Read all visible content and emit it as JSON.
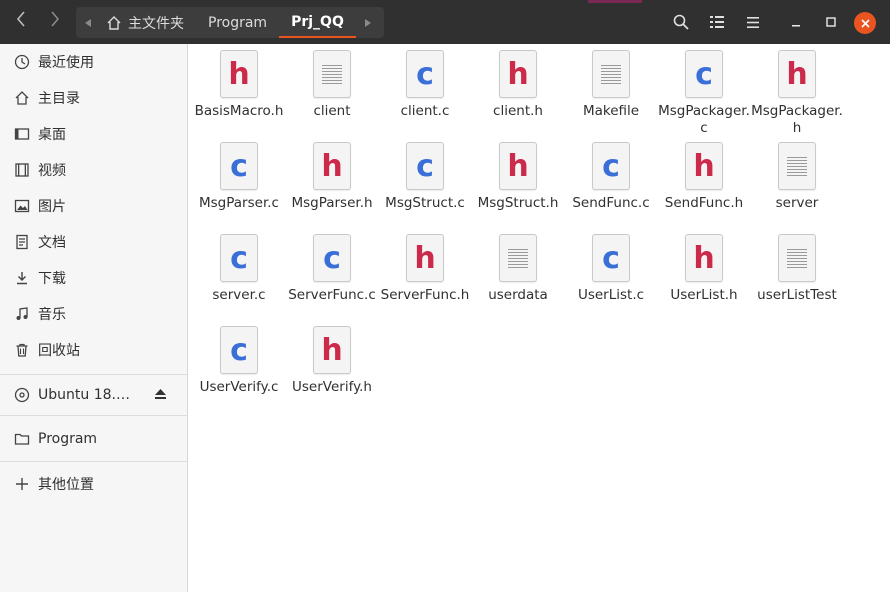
{
  "window": {
    "path": [
      {
        "label": "主文件夹",
        "icon": "home-icon"
      },
      {
        "label": "Program"
      },
      {
        "label": "Prj_QQ",
        "active": true
      }
    ]
  },
  "sidebar": {
    "places": [
      {
        "label": "最近使用",
        "icon": "clock-icon"
      },
      {
        "label": "主目录",
        "icon": "home-icon"
      },
      {
        "label": "桌面",
        "icon": "desktop-icon"
      },
      {
        "label": "视频",
        "icon": "video-icon"
      },
      {
        "label": "图片",
        "icon": "picture-icon"
      },
      {
        "label": "文档",
        "icon": "document-icon"
      },
      {
        "label": "下载",
        "icon": "download-icon"
      },
      {
        "label": "音乐",
        "icon": "music-icon"
      },
      {
        "label": "回收站",
        "icon": "trash-icon"
      }
    ],
    "devices": [
      {
        "label": "Ubuntu 18.…",
        "icon": "disc-icon",
        "action": "eject-icon"
      }
    ],
    "bookmarks": [
      {
        "label": "Program",
        "icon": "folder-icon"
      }
    ],
    "other": {
      "label": "其他位置",
      "icon": "plus-icon"
    }
  },
  "files": [
    {
      "name": "BasisMacro.h",
      "type": "h"
    },
    {
      "name": "client",
      "type": "text"
    },
    {
      "name": "client.c",
      "type": "c"
    },
    {
      "name": "client.h",
      "type": "h"
    },
    {
      "name": "Makefile",
      "type": "text"
    },
    {
      "name": "MsgPackager.c",
      "type": "c"
    },
    {
      "name": "MsgPackager.h",
      "type": "h"
    },
    {
      "name": "MsgParser.c",
      "type": "c"
    },
    {
      "name": "MsgParser.h",
      "type": "h"
    },
    {
      "name": "MsgStruct.c",
      "type": "c"
    },
    {
      "name": "MsgStruct.h",
      "type": "h"
    },
    {
      "name": "SendFunc.c",
      "type": "c"
    },
    {
      "name": "SendFunc.h",
      "type": "h"
    },
    {
      "name": "server",
      "type": "text"
    },
    {
      "name": "server.c",
      "type": "c"
    },
    {
      "name": "ServerFunc.c",
      "type": "c"
    },
    {
      "name": "ServerFunc.h",
      "type": "h"
    },
    {
      "name": "userdata",
      "type": "text"
    },
    {
      "name": "UserList.c",
      "type": "c"
    },
    {
      "name": "UserList.h",
      "type": "h"
    },
    {
      "name": "userListTest",
      "type": "text"
    },
    {
      "name": "UserVerify.c",
      "type": "c"
    },
    {
      "name": "UserVerify.h",
      "type": "h"
    }
  ],
  "colors": {
    "accent": "#e95420",
    "c_file": "#3a6fd8",
    "h_file": "#cc2a4a",
    "headerbar": "#303030"
  }
}
